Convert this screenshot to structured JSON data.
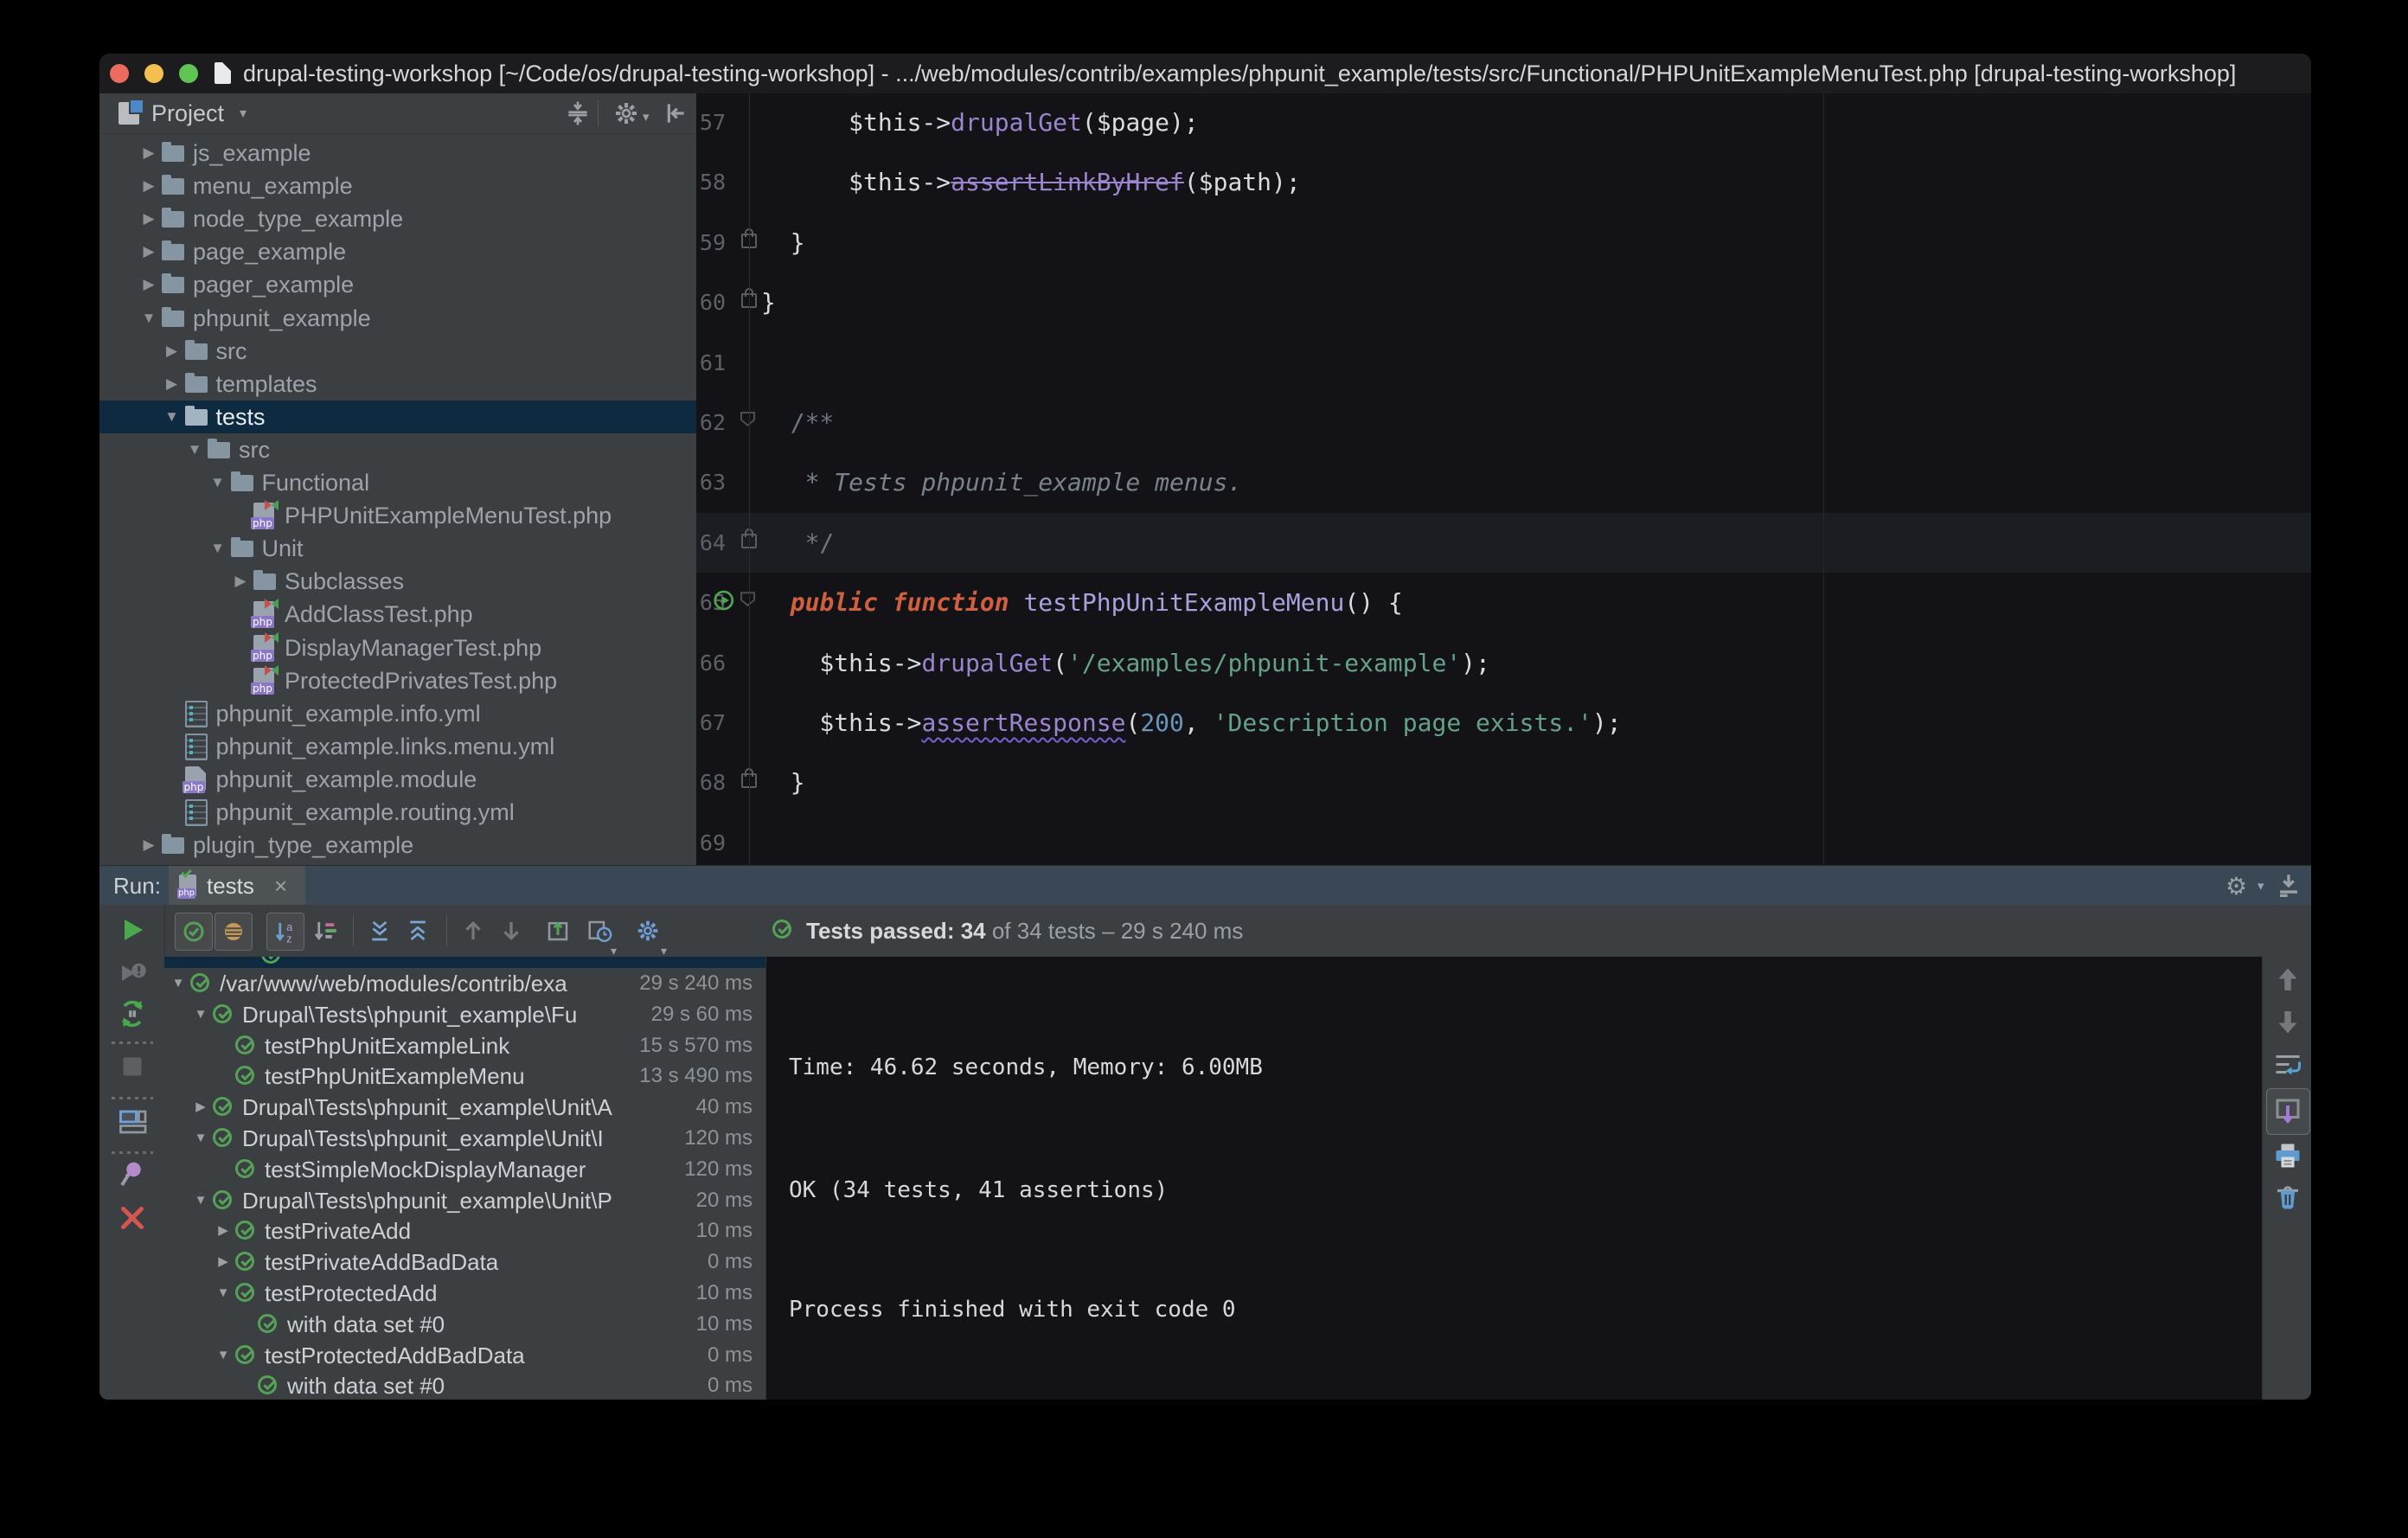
{
  "colors": {
    "selection_blue": "#0d2a40",
    "panel_gray": "#3c3f41",
    "editor_bg": "#131317",
    "pass_green": "#54a157",
    "accent_purple": "#8a77c8",
    "keyword_orange": "#d0603e",
    "string_green": "#64a187",
    "header_slate": "#3a4754"
  },
  "icons": {
    "chevron_down": "▼",
    "chevron_right": "▶",
    "dropdown": "▾",
    "close": "×",
    "gear": "⚙"
  },
  "titlebar": {
    "title": "drupal-testing-workshop [~/Code/os/drupal-testing-workshop] - .../web/modules/contrib/examples/phpunit_example/tests/src/Functional/PHPUnitExampleMenuTest.php [drupal-testing-workshop]"
  },
  "project": {
    "header": "Project",
    "items": [
      {
        "label": "js_example",
        "depth": 0,
        "arrow": "right",
        "icon": "folder"
      },
      {
        "label": "menu_example",
        "depth": 0,
        "arrow": "right",
        "icon": "folder"
      },
      {
        "label": "node_type_example",
        "depth": 0,
        "arrow": "right",
        "icon": "folder"
      },
      {
        "label": "page_example",
        "depth": 0,
        "arrow": "right",
        "icon": "folder"
      },
      {
        "label": "pager_example",
        "depth": 0,
        "arrow": "right",
        "icon": "folder"
      },
      {
        "label": "phpunit_example",
        "depth": 0,
        "arrow": "down",
        "icon": "folder"
      },
      {
        "label": "src",
        "depth": 1,
        "arrow": "right",
        "icon": "folder"
      },
      {
        "label": "templates",
        "depth": 1,
        "arrow": "right",
        "icon": "folder"
      },
      {
        "label": "tests",
        "depth": 1,
        "arrow": "down",
        "icon": "folder",
        "selected": true
      },
      {
        "label": "src",
        "depth": 2,
        "arrow": "down",
        "icon": "folder"
      },
      {
        "label": "Functional",
        "depth": 3,
        "arrow": "down",
        "icon": "folder"
      },
      {
        "label": "PHPUnitExampleMenuTest.php",
        "depth": 4,
        "arrow": null,
        "icon": "php"
      },
      {
        "label": "Unit",
        "depth": 3,
        "arrow": "down",
        "icon": "folder"
      },
      {
        "label": "Subclasses",
        "depth": 4,
        "arrow": "right",
        "icon": "folder"
      },
      {
        "label": "AddClassTest.php",
        "depth": 4,
        "arrow": null,
        "icon": "php"
      },
      {
        "label": "DisplayManagerTest.php",
        "depth": 4,
        "arrow": null,
        "icon": "php"
      },
      {
        "label": "ProtectedPrivatesTest.php",
        "depth": 4,
        "arrow": null,
        "icon": "php"
      },
      {
        "label": "phpunit_example.info.yml",
        "depth": 1,
        "arrow": null,
        "icon": "yml"
      },
      {
        "label": "phpunit_example.links.menu.yml",
        "depth": 1,
        "arrow": null,
        "icon": "yml"
      },
      {
        "label": "phpunit_example.module",
        "depth": 1,
        "arrow": null,
        "icon": "module"
      },
      {
        "label": "phpunit_example.routing.yml",
        "depth": 1,
        "arrow": null,
        "icon": "yml"
      },
      {
        "label": "plugin_type_example",
        "depth": 0,
        "arrow": "right",
        "icon": "folder"
      }
    ]
  },
  "editor": {
    "lines": [
      {
        "num": "57",
        "gutter": [],
        "segs": [
          [
            "pl",
            "      $this->"
          ],
          [
            "meth",
            "drupalGet"
          ],
          [
            "pl",
            "($page);"
          ]
        ]
      },
      {
        "num": "58",
        "gutter": [],
        "segs": [
          [
            "pl",
            "      $this->"
          ],
          [
            "dep",
            "assertLinkByHref"
          ],
          [
            "pl",
            "($path);"
          ]
        ]
      },
      {
        "num": "59",
        "gutter": [
          "lock"
        ],
        "segs": [
          [
            "pl",
            "  }"
          ]
        ]
      },
      {
        "num": "60",
        "gutter": [
          "lock"
        ],
        "segs": [
          [
            "pl",
            "}"
          ]
        ]
      },
      {
        "num": "61",
        "gutter": [],
        "segs": []
      },
      {
        "num": "62",
        "gutter": [
          "fold"
        ],
        "segs": [
          [
            "cmt",
            "  /**"
          ]
        ]
      },
      {
        "num": "63",
        "gutter": [],
        "segs": [
          [
            "doc",
            "   * Tests phpunit_example menus."
          ]
        ]
      },
      {
        "num": "64",
        "gutter": [
          "lock"
        ],
        "current": true,
        "segs": [
          [
            "cmt",
            "   */"
          ]
        ]
      },
      {
        "num": "65",
        "gutter": [
          "run",
          "fold"
        ],
        "segs": [
          [
            "pl",
            "  "
          ],
          [
            "kw",
            "public function "
          ],
          [
            "fn",
            "testPhpUnitExampleMenu"
          ],
          [
            "pl",
            "() {"
          ]
        ]
      },
      {
        "num": "66",
        "gutter": [],
        "segs": [
          [
            "pl",
            "    $this->"
          ],
          [
            "meth",
            "drupalGet"
          ],
          [
            "pl",
            "("
          ],
          [
            "str",
            "'/examples/phpunit-example'"
          ],
          [
            "pl",
            ");"
          ]
        ]
      },
      {
        "num": "67",
        "gutter": [],
        "segs": [
          [
            "pl",
            "    $this->"
          ],
          [
            "warn",
            "assertResponse"
          ],
          [
            "pl",
            "("
          ],
          [
            "num",
            "200"
          ],
          [
            "pl",
            ", "
          ],
          [
            "str",
            "'Description page exists.'"
          ],
          [
            "pl",
            ");"
          ]
        ]
      },
      {
        "num": "68",
        "gutter": [
          "lock"
        ],
        "segs": [
          [
            "pl",
            "  }"
          ]
        ]
      },
      {
        "num": "69",
        "gutter": [],
        "segs": []
      }
    ]
  },
  "run": {
    "label": "Run:",
    "tab": {
      "title": "tests"
    },
    "status": {
      "passed": "Tests passed: 34",
      "rest": " of 34 tests – 29 s 240 ms"
    },
    "tree": [
      {
        "depth": 1,
        "arrow": "down",
        "label": "/var/www/web/modules/contrib/exa",
        "time": "29 s 240 ms"
      },
      {
        "depth": 2,
        "arrow": "down",
        "label": "Drupal\\Tests\\phpunit_example\\Fu",
        "time": "29 s 60 ms"
      },
      {
        "depth": 3,
        "arrow": null,
        "label": "testPhpUnitExampleLink",
        "time": "15 s 570 ms"
      },
      {
        "depth": 3,
        "arrow": null,
        "label": "testPhpUnitExampleMenu",
        "time": "13 s 490 ms"
      },
      {
        "depth": 2,
        "arrow": "right",
        "label": "Drupal\\Tests\\phpunit_example\\Unit\\A",
        "time": "40 ms"
      },
      {
        "depth": 2,
        "arrow": "down",
        "label": "Drupal\\Tests\\phpunit_example\\Unit\\I",
        "time": "120 ms"
      },
      {
        "depth": 3,
        "arrow": null,
        "label": "testSimpleMockDisplayManager",
        "time": "120 ms"
      },
      {
        "depth": 2,
        "arrow": "down",
        "label": "Drupal\\Tests\\phpunit_example\\Unit\\P",
        "time": "20 ms"
      },
      {
        "depth": 3,
        "arrow": "right",
        "label": "testPrivateAdd",
        "time": "10 ms"
      },
      {
        "depth": 3,
        "arrow": "right",
        "label": "testPrivateAddBadData",
        "time": "0 ms"
      },
      {
        "depth": 3,
        "arrow": "down",
        "label": "testProtectedAdd",
        "time": "10 ms"
      },
      {
        "depth": 4,
        "arrow": null,
        "label": "with data set #0",
        "time": "10 ms"
      },
      {
        "depth": 3,
        "arrow": "down",
        "label": "testProtectedAddBadData",
        "time": "0 ms"
      },
      {
        "depth": 4,
        "arrow": null,
        "label": "with data set #0",
        "time": "0 ms"
      }
    ],
    "console": [
      "Time: 46.62 seconds, Memory: 6.00MB",
      "OK (34 tests, 41 assertions)",
      "Process finished with exit code 0"
    ]
  }
}
